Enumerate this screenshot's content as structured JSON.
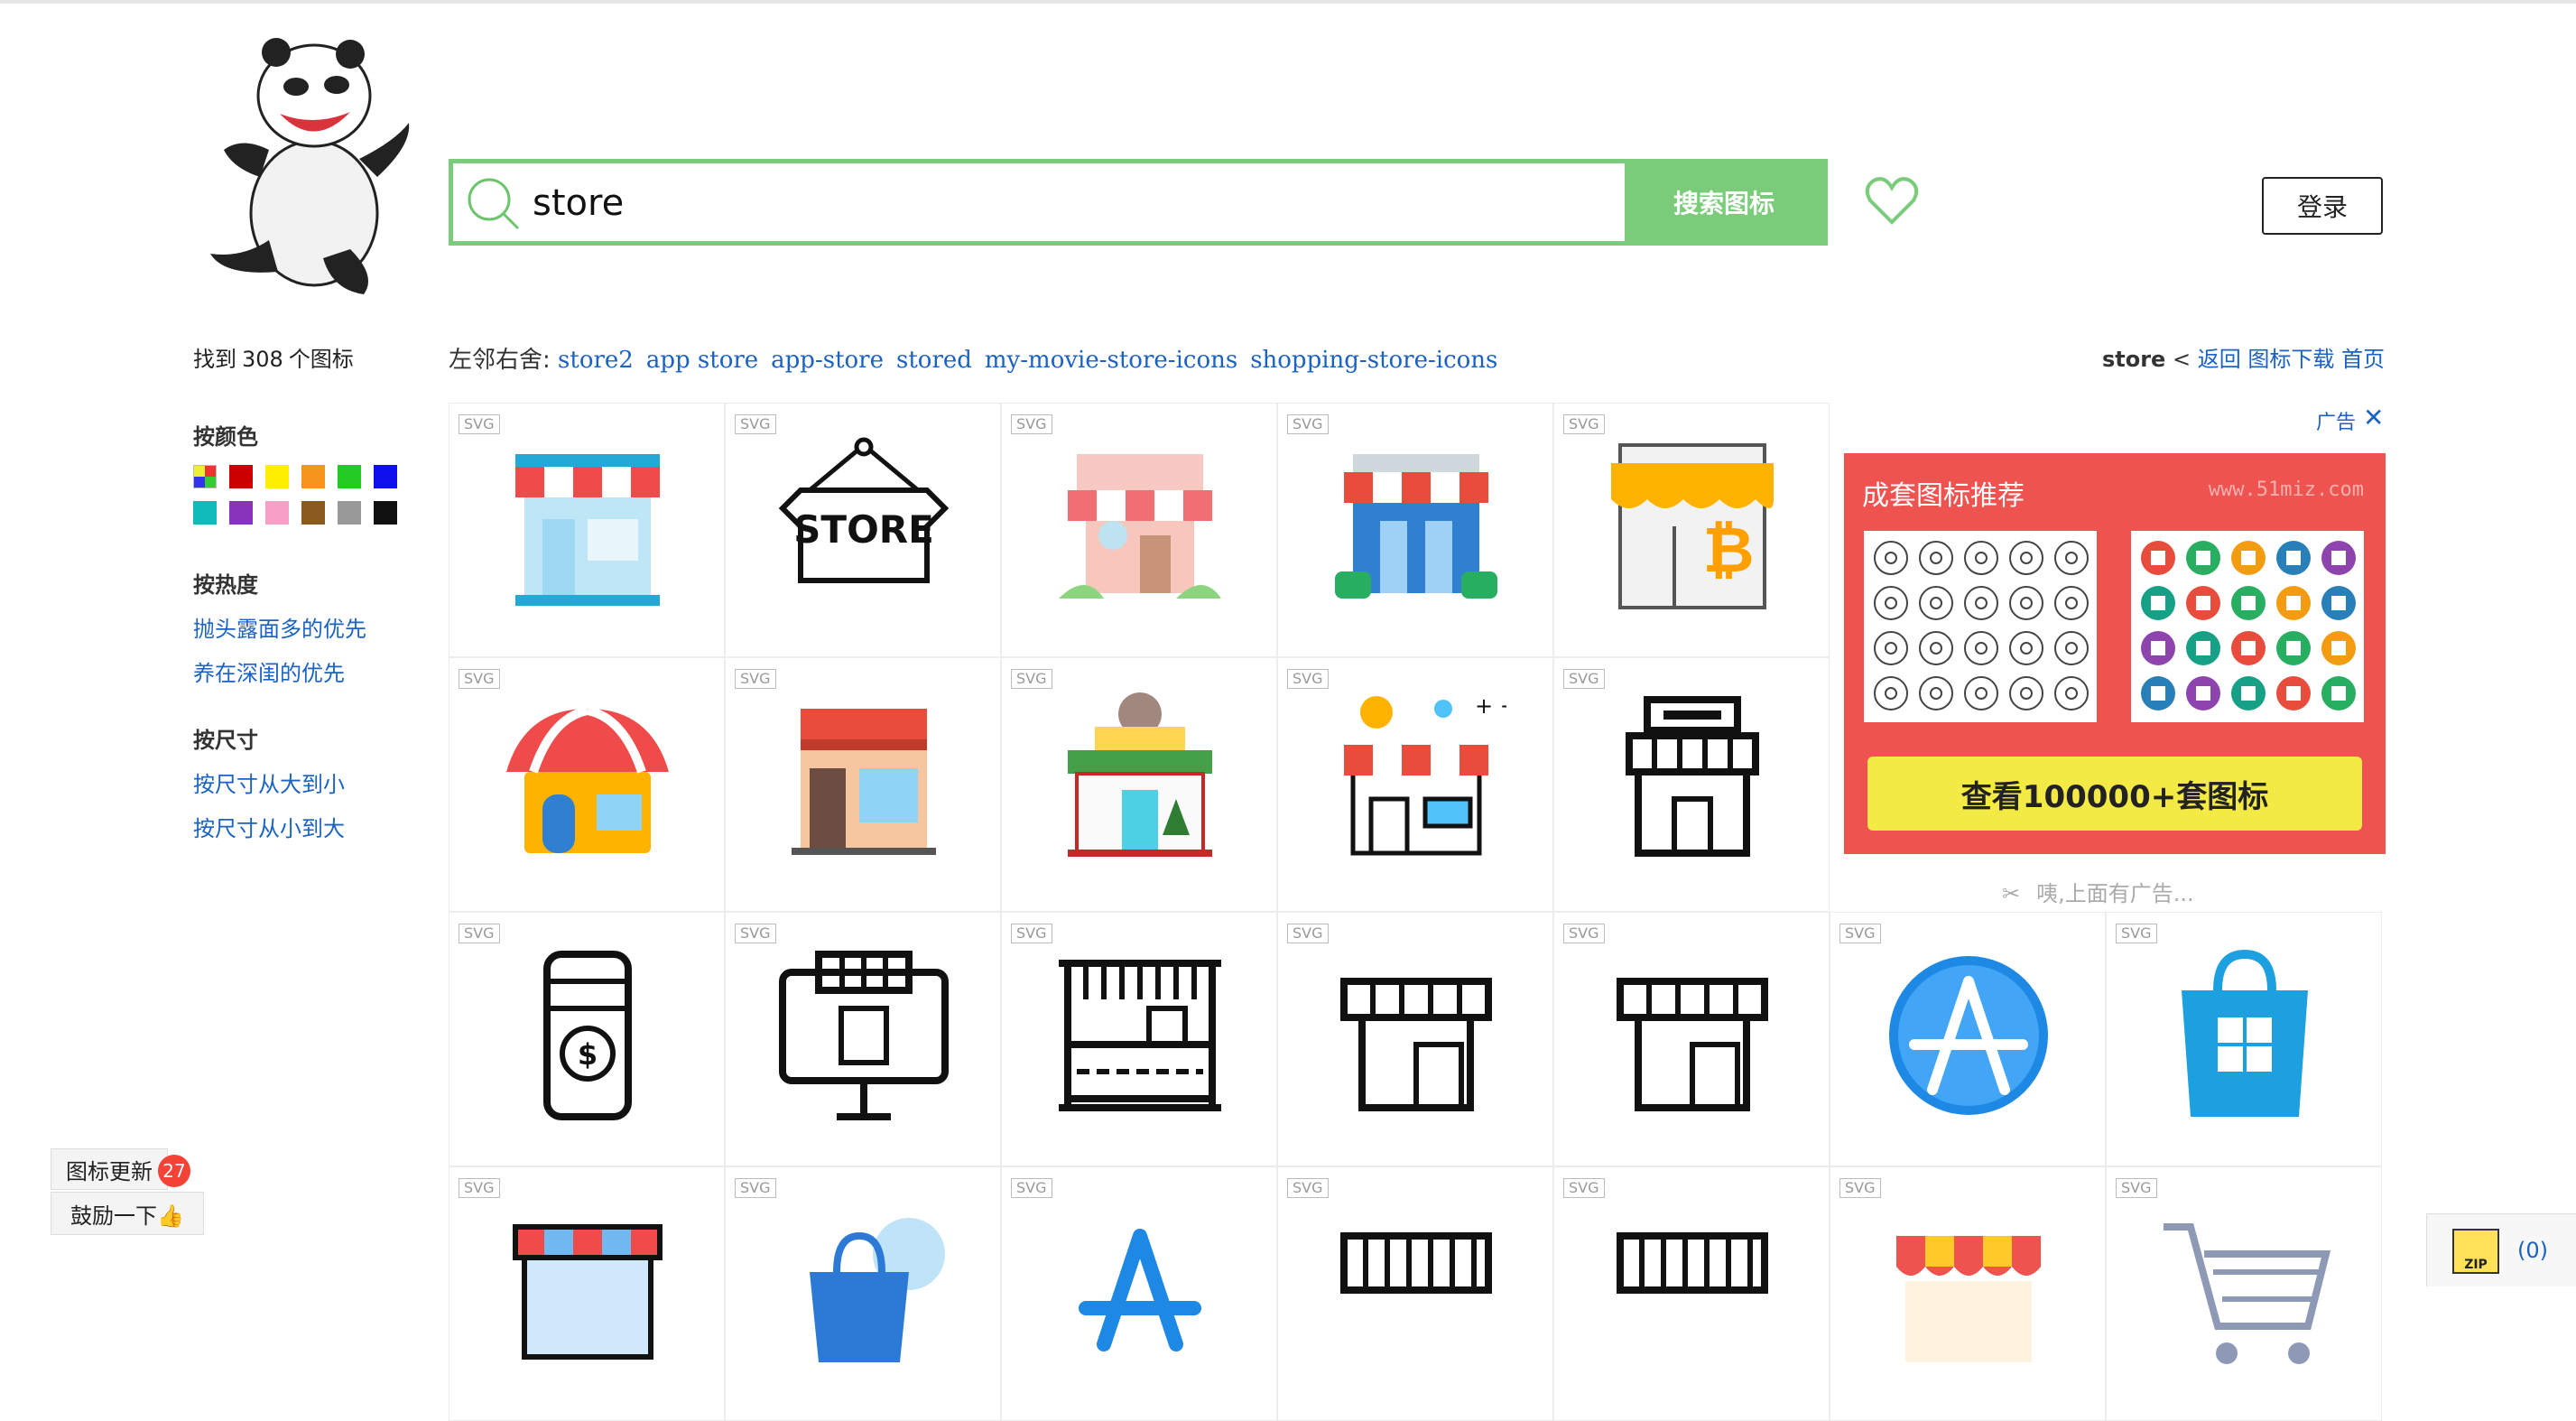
{
  "search": {
    "value": "store",
    "button": "搜索图标"
  },
  "login": "登录",
  "found": {
    "prefix": "找到",
    "count": "308",
    "suffix": "个图标"
  },
  "related": {
    "label": "左邻右舍:",
    "items": [
      "store2",
      "app store",
      "app-store",
      "stored",
      "my-movie-store-icons",
      "shopping-store-icons"
    ]
  },
  "breadcrumb": {
    "current": "store",
    "sep": "<",
    "links": [
      "返回",
      "图标下载",
      "首页"
    ]
  },
  "sidebar": {
    "color_title": "按颜色",
    "colors": [
      "multi",
      "#cc0000",
      "#ffee00",
      "#f7941d",
      "#22cc22",
      "#1010ee",
      "#11bbbb",
      "#8833bb",
      "#f6a0c8",
      "#8a5a1e",
      "#999999",
      "#111111"
    ],
    "heat_title": "按热度",
    "heat_options": [
      "抛头露面多的优先",
      "养在深闺的优先"
    ],
    "size_title": "按尺寸",
    "size_options": [
      "按尺寸从大到小",
      "按尺寸从小到大"
    ]
  },
  "icons": {
    "badge": "SVG",
    "items": [
      "store-flat-icon",
      "store-sign-icon",
      "house-shop-icon",
      "blue-store-icon",
      "bitcoin-store-icon",
      "red-awning-store-icon",
      "shop-window-icon",
      "toy-store-icon",
      "bakery-store-icon",
      "outline-kiosk-icon",
      "mobile-shop-icon",
      "online-shop-icon",
      "market-stall-icon",
      "store-outline-icon",
      "store-outline-icon",
      "app-store-icon",
      "windows-store-icon",
      "blue-awning-icon",
      "shopping-bag-icon",
      "app-store-logo-icon",
      "awning-outline-icon",
      "awning-outline-icon",
      "striped-awning-icon",
      "shopping-cart-icon"
    ]
  },
  "ad": {
    "label": "广告",
    "title": "成套图标推荐",
    "watermark": "www.51miz.com",
    "cta": "查看100000+套图标",
    "note": "咦,上面有广告..."
  },
  "updates": {
    "label": "图标更新",
    "count": "27"
  },
  "encourage": "鼓励一下👍",
  "zip": {
    "label": "ZIP",
    "count": "(0)"
  }
}
